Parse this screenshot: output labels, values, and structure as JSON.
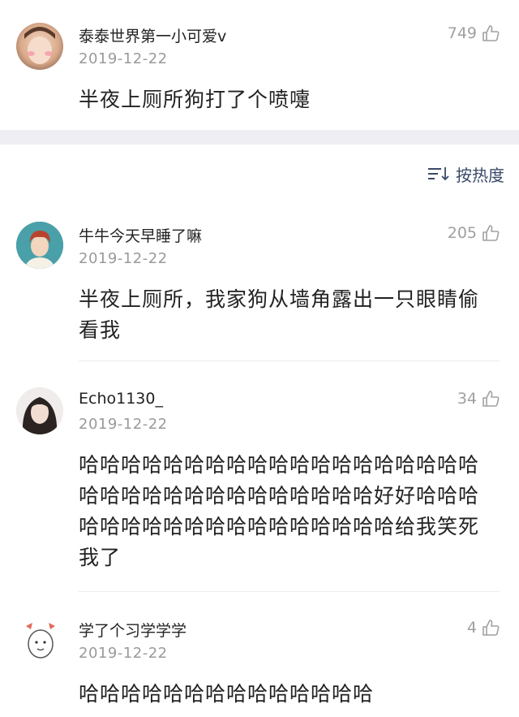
{
  "top_comment": {
    "username": "泰泰世界第一小可爱v",
    "date": "2019-12-22",
    "likes": "749",
    "text": "半夜上厕所狗打了个喷嚏"
  },
  "sort": {
    "label": "按热度"
  },
  "replies": [
    {
      "username": "牛牛今天早睡了嘛",
      "date": "2019-12-22",
      "likes": "205",
      "text": "半夜上厕所，我家狗从墙角露出一只眼睛偷看我"
    },
    {
      "username": "Echo1130_",
      "date": "2019-12-22",
      "likes": "34",
      "text": "哈哈哈哈哈哈哈哈哈哈哈哈哈哈哈哈哈哈哈哈哈哈哈哈哈哈哈哈哈哈哈哈哈好好哈哈哈哈哈哈哈哈哈哈哈哈哈哈哈哈哈哈给我笑死我了"
    },
    {
      "username": "学了个习学学学",
      "date": "2019-12-22",
      "likes": "4",
      "text": "哈哈哈哈哈哈哈哈哈哈哈哈哈哈"
    }
  ],
  "colors": {
    "accent": "#3a4a68",
    "muted": "#9a9a9a",
    "band": "#efeff3"
  }
}
